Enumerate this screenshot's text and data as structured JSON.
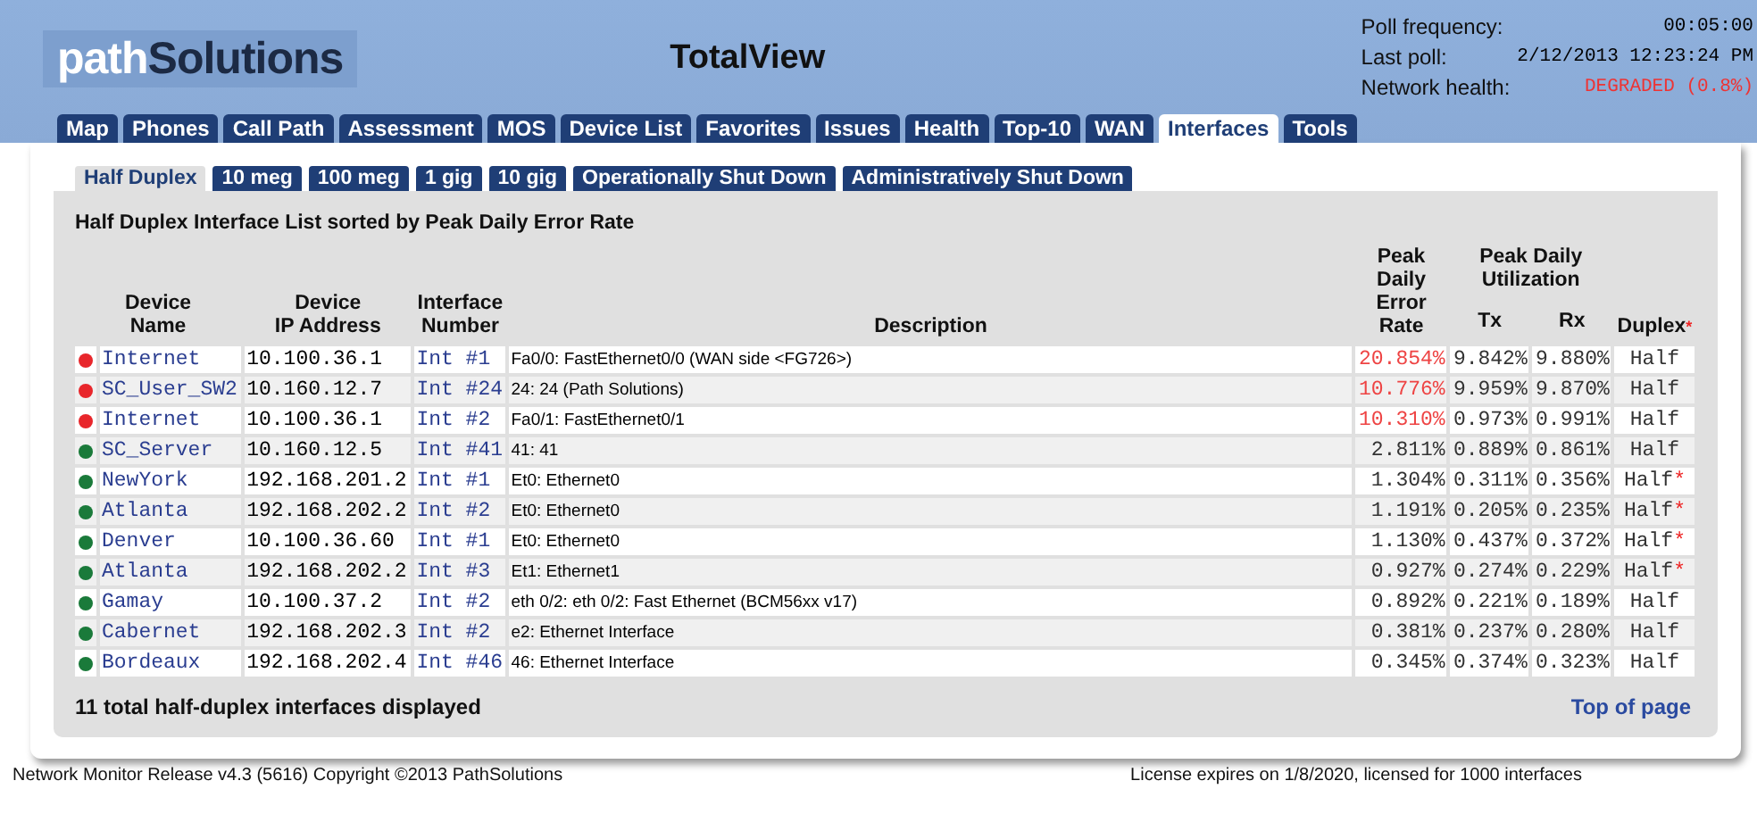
{
  "header": {
    "logo": {
      "prefix": "path",
      "name": "Solutions"
    },
    "title": "TotalView",
    "poll": [
      {
        "label": "Poll frequency:",
        "value": "00:05:00",
        "alert": false
      },
      {
        "label": "Last poll:",
        "value": "2/12/2013 12:23:24 PM",
        "alert": false
      },
      {
        "label": "Network health:",
        "value": "DEGRADED (0.8%)",
        "alert": true
      }
    ]
  },
  "tabs": [
    {
      "label": "Map",
      "selected": false
    },
    {
      "label": "Phones",
      "selected": false
    },
    {
      "label": "Call Path",
      "selected": false
    },
    {
      "label": "Assessment",
      "selected": false
    },
    {
      "label": "MOS",
      "selected": false
    },
    {
      "label": "Device List",
      "selected": false
    },
    {
      "label": "Favorites",
      "selected": false
    },
    {
      "label": "Issues",
      "selected": false
    },
    {
      "label": "Health",
      "selected": false
    },
    {
      "label": "Top-10",
      "selected": false
    },
    {
      "label": "WAN",
      "selected": false
    },
    {
      "label": "Interfaces",
      "selected": true
    },
    {
      "label": "Tools",
      "selected": false
    }
  ],
  "subtabs": [
    {
      "label": "Half Duplex",
      "selected": true
    },
    {
      "label": "10 meg",
      "selected": false
    },
    {
      "label": "100 meg",
      "selected": false
    },
    {
      "label": "1 gig",
      "selected": false
    },
    {
      "label": "10 gig",
      "selected": false
    },
    {
      "label": "Operationally Shut Down",
      "selected": false
    },
    {
      "label": "Administratively Shut Down",
      "selected": false
    }
  ],
  "table": {
    "title": "Half Duplex Interface List sorted by Peak Daily Error Rate",
    "columns": {
      "device": "Device\nName",
      "ip": "Device\nIP Address",
      "interface": "Interface\nNumber",
      "description": "Description",
      "error_rate": "Peak\nDaily\nError\nRate",
      "utilization": "Peak Daily\nUtilization",
      "tx": "Tx",
      "rx": "Rx",
      "duplex": "Duplex",
      "duplex_note": "*"
    },
    "rows": [
      {
        "color": "#e8262b",
        "device": "Internet",
        "ip": "10.100.36.1",
        "interface": "Int #1",
        "description": "Fa0/0: FastEthernet0/0 (WAN side <FG726>)",
        "error_rate": "20.854%",
        "alert": true,
        "tx": "9.842%",
        "rx": "9.880%",
        "duplex": "Half",
        "flag": ""
      },
      {
        "color": "#e8262b",
        "device": "SC_User_SW2",
        "ip": "10.160.12.7",
        "interface": "Int #24",
        "description": "24: 24 (Path Solutions)",
        "error_rate": "10.776%",
        "alert": true,
        "tx": "9.959%",
        "rx": "9.870%",
        "duplex": "Half",
        "flag": ""
      },
      {
        "color": "#e8262b",
        "device": "Internet",
        "ip": "10.100.36.1",
        "interface": "Int #2",
        "description": "Fa0/1: FastEthernet0/1",
        "error_rate": "10.310%",
        "alert": true,
        "tx": "0.973%",
        "rx": "0.991%",
        "duplex": "Half",
        "flag": ""
      },
      {
        "color": "#1a7a3a",
        "device": "SC_Server",
        "ip": "10.160.12.5",
        "interface": "Int #41",
        "description": "41: 41",
        "error_rate": "2.811%",
        "alert": false,
        "tx": "0.889%",
        "rx": "0.861%",
        "duplex": "Half",
        "flag": ""
      },
      {
        "color": "#1a7a3a",
        "device": "NewYork",
        "ip": "192.168.201.2",
        "interface": "Int #1",
        "description": "Et0: Ethernet0",
        "error_rate": "1.304%",
        "alert": false,
        "tx": "0.311%",
        "rx": "0.356%",
        "duplex": "Half",
        "flag": "*"
      },
      {
        "color": "#1a7a3a",
        "device": "Atlanta",
        "ip": "192.168.202.2",
        "interface": "Int #2",
        "description": "Et0: Ethernet0",
        "error_rate": "1.191%",
        "alert": false,
        "tx": "0.205%",
        "rx": "0.235%",
        "duplex": "Half",
        "flag": "*"
      },
      {
        "color": "#1a7a3a",
        "device": "Denver",
        "ip": "10.100.36.60",
        "interface": "Int #1",
        "description": "Et0: Ethernet0",
        "error_rate": "1.130%",
        "alert": false,
        "tx": "0.437%",
        "rx": "0.372%",
        "duplex": "Half",
        "flag": "*"
      },
      {
        "color": "#1a7a3a",
        "device": "Atlanta",
        "ip": "192.168.202.2",
        "interface": "Int #3",
        "description": "Et1: Ethernet1",
        "error_rate": "0.927%",
        "alert": false,
        "tx": "0.274%",
        "rx": "0.229%",
        "duplex": "Half",
        "flag": "*"
      },
      {
        "color": "#1a7a3a",
        "device": "Gamay",
        "ip": "10.100.37.2",
        "interface": "Int #2",
        "description": "eth 0/2: eth 0/2: Fast Ethernet (BCM56xx v17)",
        "error_rate": "0.892%",
        "alert": false,
        "tx": "0.221%",
        "rx": "0.189%",
        "duplex": "Half",
        "flag": ""
      },
      {
        "color": "#1a7a3a",
        "device": "Cabernet",
        "ip": "192.168.202.3",
        "interface": "Int #2",
        "description": "e2: Ethernet Interface",
        "error_rate": "0.381%",
        "alert": false,
        "tx": "0.237%",
        "rx": "0.280%",
        "duplex": "Half",
        "flag": ""
      },
      {
        "color": "#1a7a3a",
        "device": "Bordeaux",
        "ip": "192.168.202.4",
        "interface": "Int #46",
        "description": "46: Ethernet Interface",
        "error_rate": "0.345%",
        "alert": false,
        "tx": "0.374%",
        "rx": "0.323%",
        "duplex": "Half",
        "flag": ""
      }
    ],
    "summary": "11 total half-duplex interfaces displayed",
    "top_link": "Top of page"
  },
  "footer": {
    "left": "Network Monitor Release v4.3 (5616) Copyright ©2013 PathSolutions",
    "right": "License expires on 1/8/2020, licensed for 1000 interfaces"
  }
}
